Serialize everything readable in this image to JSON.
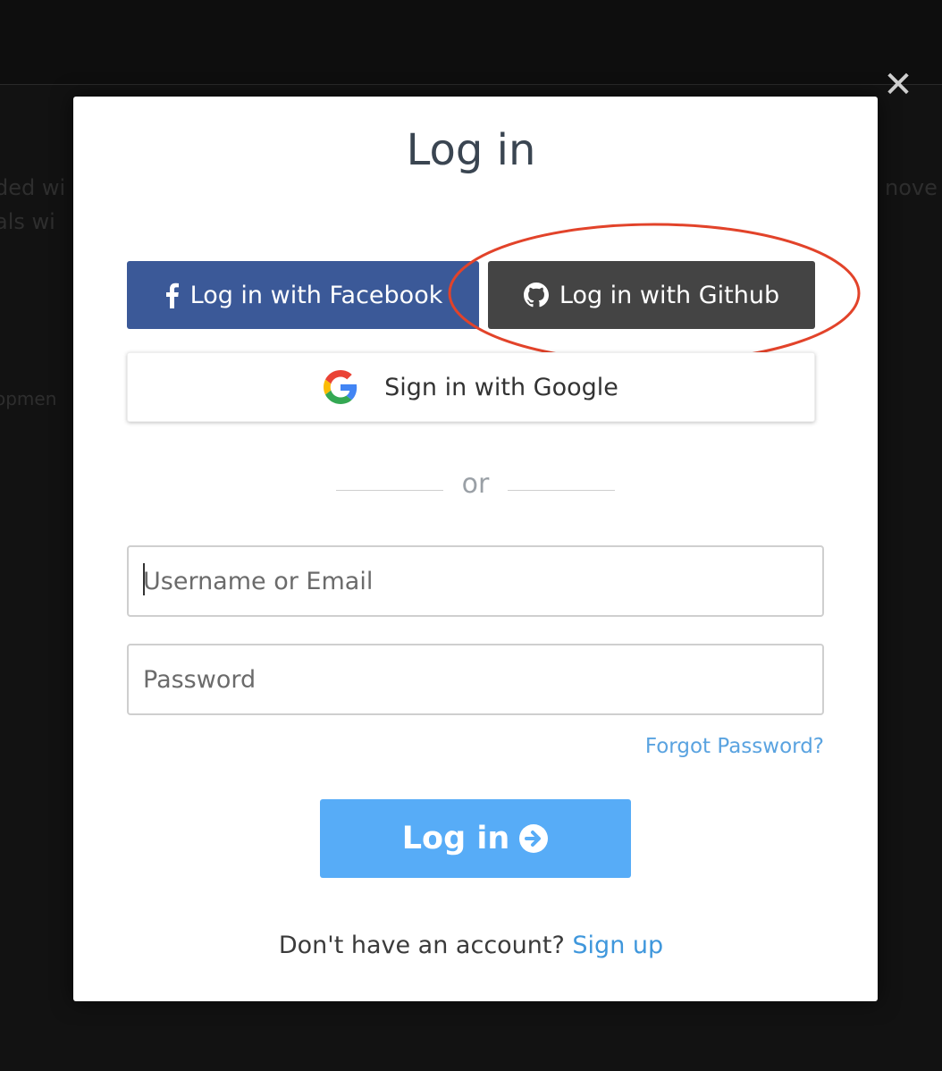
{
  "background": {
    "fragments": [
      "ded wi",
      "als wi",
      "opmen",
      "nove"
    ]
  },
  "modal": {
    "close_glyph": "✕",
    "title": "Log in",
    "facebook_label": "Log in with Facebook",
    "github_label": "Log in with Github",
    "google_label": "Sign in with Google",
    "divider_text": "or",
    "username_placeholder": "Username or Email",
    "password_placeholder": "Password",
    "forgot_label": "Forgot Password?",
    "login_label": "Log in",
    "signup_prompt": "Don't have an account?",
    "signup_label": "Sign up"
  },
  "colors": {
    "facebook": "#3b5998",
    "github": "#444444",
    "login": "#57acf7",
    "link": "#3f97dc",
    "highlight": "#e2432a"
  },
  "icons": {
    "facebook": "facebook-icon",
    "github": "github-icon",
    "google": "google-icon",
    "arrow": "arrow-circle-right-icon",
    "close": "close-icon"
  }
}
